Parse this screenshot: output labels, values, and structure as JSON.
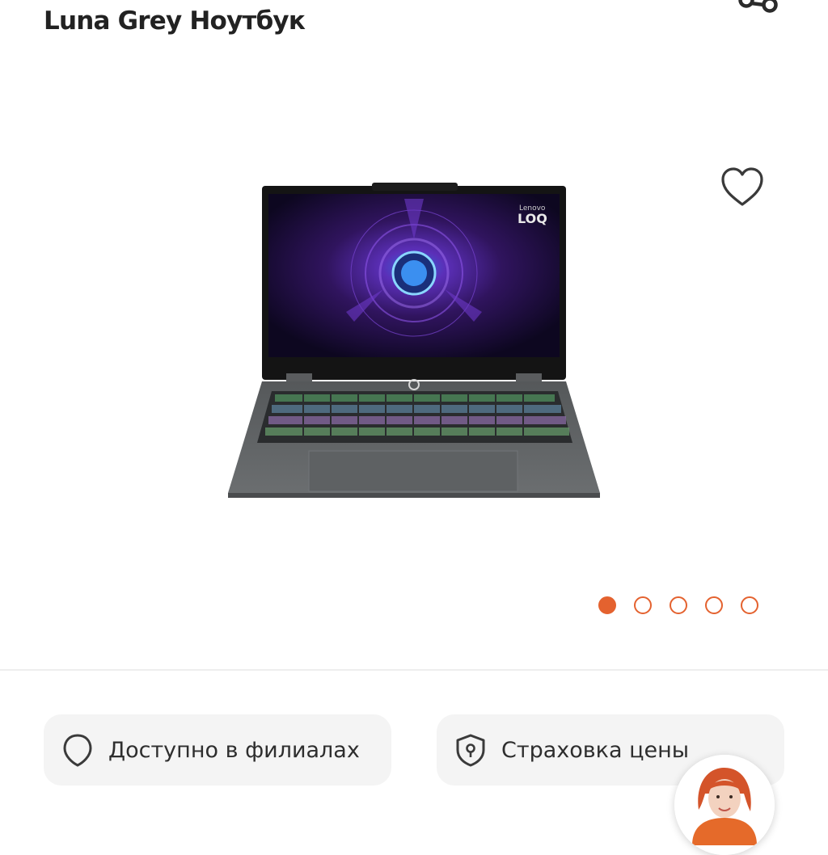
{
  "header": {
    "title": "Luna Grey Ноутбук",
    "share_icon": "share-icon"
  },
  "gallery": {
    "favorite_icon": "heart-icon",
    "image_alt": "Lenovo LOQ laptop",
    "screen_brand": "Lenovo",
    "screen_model": "LOQ",
    "slide_count": 5,
    "active_slide": 1
  },
  "colors": {
    "accent": "#e4622f",
    "chip_bg": "#f4f4f4"
  },
  "actions": {
    "branches_label": "Доступно в филиалах",
    "branches_icon": "location-pin-icon",
    "insurance_label": "Страховка цены",
    "insurance_icon": "shield-icon"
  },
  "assistant": {
    "icon": "assistant-avatar"
  }
}
